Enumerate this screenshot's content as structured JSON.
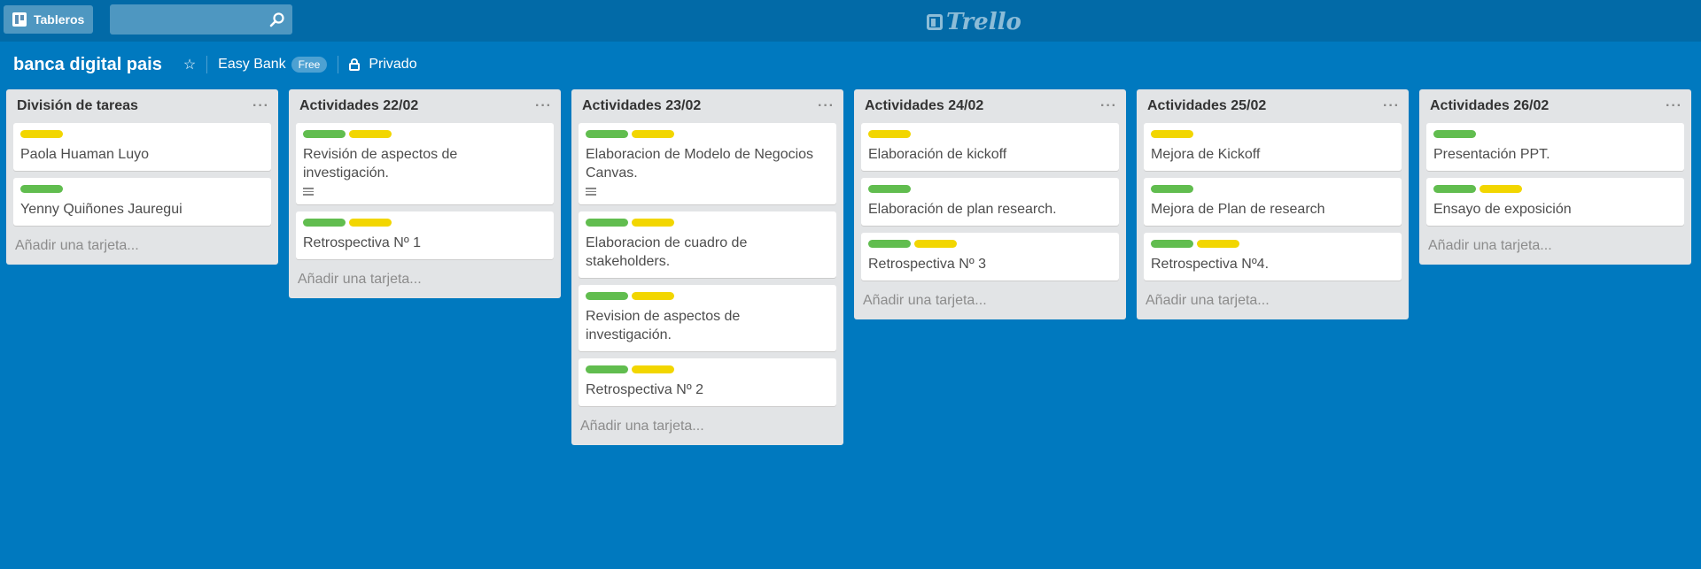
{
  "header": {
    "boards_label": "Tableros",
    "search": {
      "value": "",
      "placeholder": ""
    },
    "logo_text": "Trello"
  },
  "board": {
    "title": "banca digital pais",
    "team": "Easy Bank",
    "team_badge": "Free",
    "privacy": "Privado"
  },
  "add_card_label": "Añadir una tarjeta...",
  "list_menu": "···",
  "lists": [
    {
      "title": "División de tareas",
      "cards": [
        {
          "labels": [
            "yellow"
          ],
          "text": "Paola Huaman Luyo"
        },
        {
          "labels": [
            "green"
          ],
          "text": "Yenny Quiñones Jauregui"
        }
      ]
    },
    {
      "title": "Actividades 22/02",
      "cards": [
        {
          "labels": [
            "green",
            "yellow"
          ],
          "text": "Revisión de aspectos de investigación.",
          "description": true
        },
        {
          "labels": [
            "green",
            "yellow"
          ],
          "text": "Retrospectiva Nº 1"
        }
      ]
    },
    {
      "title": "Actividades 23/02",
      "cards": [
        {
          "labels": [
            "green",
            "yellow"
          ],
          "text": "Elaboracion de Modelo de Negocios Canvas.",
          "description": true
        },
        {
          "labels": [
            "green",
            "yellow"
          ],
          "text": "Elaboracion de cuadro de stakeholders."
        },
        {
          "labels": [
            "green",
            "yellow"
          ],
          "text": "Revision de aspectos de investigación."
        },
        {
          "labels": [
            "green",
            "yellow"
          ],
          "text": "Retrospectiva Nº 2"
        }
      ]
    },
    {
      "title": "Actividades 24/02",
      "cards": [
        {
          "labels": [
            "yellow"
          ],
          "text": "Elaboración de kickoff"
        },
        {
          "labels": [
            "green"
          ],
          "text": "Elaboración de plan research."
        },
        {
          "labels": [
            "green",
            "yellow"
          ],
          "text": "Retrospectiva Nº 3"
        }
      ]
    },
    {
      "title": "Actividades 25/02",
      "cards": [
        {
          "labels": [
            "yellow"
          ],
          "text": "Mejora de Kickoff"
        },
        {
          "labels": [
            "green"
          ],
          "text": "Mejora de Plan de research"
        },
        {
          "labels": [
            "green",
            "yellow"
          ],
          "text": "Retrospectiva Nº4."
        }
      ]
    },
    {
      "title": "Actividades 26/02",
      "cards": [
        {
          "labels": [
            "green"
          ],
          "text": "Presentación PPT."
        },
        {
          "labels": [
            "green",
            "yellow"
          ],
          "text": "Ensayo de exposición"
        }
      ]
    }
  ],
  "colors": {
    "background": "#0079bf",
    "header": "#026aa7",
    "label_green": "#61bd4f",
    "label_yellow": "#f2d600"
  }
}
